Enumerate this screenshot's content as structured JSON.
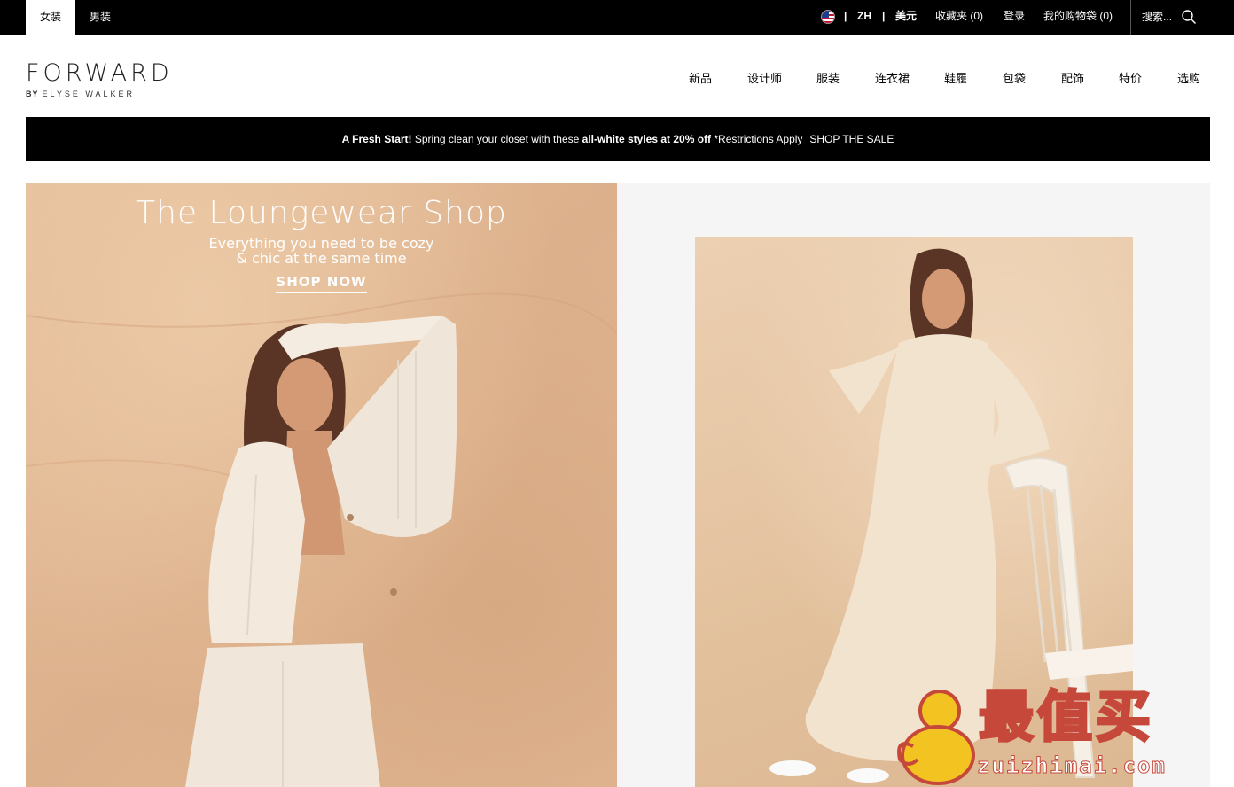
{
  "topbar": {
    "tabs": [
      {
        "label": "女装",
        "active": true
      },
      {
        "label": "男装",
        "active": false
      }
    ],
    "language": "ZH",
    "currency": "美元",
    "separator": "|",
    "wishlist": "收藏夹 (0)",
    "login": "登录",
    "cart": "我的购物袋 (0)",
    "search_placeholder": "搜索..."
  },
  "header": {
    "logo_main": "FORWARD",
    "logo_by": "BY",
    "logo_sub": "ELYSE WALKER",
    "nav": [
      "新品",
      "设计师",
      "服装",
      "连衣裙",
      "鞋履",
      "包袋",
      "配饰",
      "特价",
      "选购"
    ]
  },
  "promo": {
    "lead": "A Fresh Start!",
    "text1": " Spring clean your closet with these ",
    "highlight": "all-white styles at 20% off",
    "text2": " *Restrictions Apply",
    "cta": "SHOP THE SALE"
  },
  "hero": {
    "title": "The Loungewear Shop",
    "subtitle_line1": "Everything you need to be cozy",
    "subtitle_line2": "& chic at the same time",
    "cta": "SHOP NOW"
  },
  "watermark": {
    "text": "最值买",
    "url": "zuizhimai.com"
  },
  "colors": {
    "topbar_bg": "#000000",
    "promo_bg": "#000000",
    "hero_bg": "#e0b691",
    "right_panel_bg": "#f5f5f5",
    "watermark_yellow": "#f3c321",
    "watermark_red": "#c5483a"
  }
}
